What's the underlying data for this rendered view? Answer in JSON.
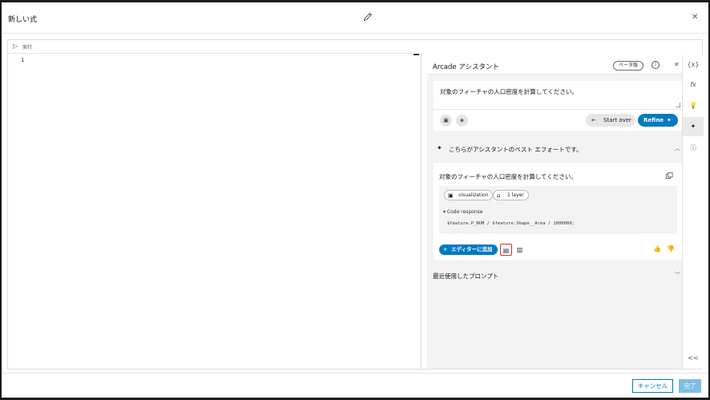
{
  "dialog": {
    "title": "新しい式",
    "run_label": "実行",
    "line_number": "1"
  },
  "assistant": {
    "title": "Arcade アシスタント",
    "beta_badge": "ベータ版",
    "prompt_text": "対象のフィーチャの人口密度を計算してください。",
    "start_over_label": "Start over",
    "refine_label": "Refine",
    "best_effort_text": "こちらがアシスタントのベスト エフォートです。",
    "response": {
      "prompt": "対象のフィーチャの人口密度を計算してください。",
      "chip_visualization": "visualization",
      "chip_layer": "1 layer",
      "code_response_label": "▾ Code response",
      "code": "$feature.P_NUM / $feature.Shape__Area / 1000000;",
      "add_to_editor": "エディターに追加"
    },
    "recent_prompts": "最近使用したプロンプト"
  },
  "rail": {
    "items": [
      "{x}",
      "fx",
      "bulb-icon",
      "assistant-icon",
      "help-icon"
    ],
    "collapse": "<<"
  },
  "footer": {
    "cancel": "キャンセル",
    "done": "完了"
  },
  "colors": {
    "accent": "#007ac2",
    "highlight": "#d62b2b"
  }
}
